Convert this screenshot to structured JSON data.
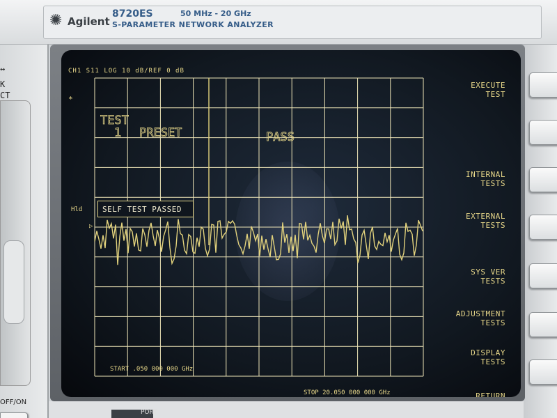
{
  "panel": {
    "brand": "Agilent",
    "model": "8720ES",
    "freq_range": "50 MHz - 20 GHz",
    "description": "S-PARAMETER NETWORK ANALYZER",
    "left_labels": [
      "↔",
      "K",
      "CT"
    ],
    "power_label": "OFF/ON",
    "bottom_label": "PORT"
  },
  "display": {
    "status_line": "CH1  S11  LOG    10 dB/REF 0 dB",
    "star": "*",
    "hold_label": "Hld",
    "marker": "▷",
    "test_label": "TEST",
    "test_number": "1",
    "test_name": "PRESET",
    "result": "PASS",
    "message": "SELF TEST PASSED",
    "start": "START .050 000 000 GHz",
    "stop": "STOP 20.050 000 000 GHz"
  },
  "softkeys": [
    {
      "line1": "EXECUTE",
      "line2": "TEST"
    },
    {
      "line1": "INTERNAL",
      "line2": "TESTS"
    },
    {
      "line1": "EXTERNAL",
      "line2": "TESTS"
    },
    {
      "line1": "SYS VER",
      "line2": "TESTS"
    },
    {
      "line1": "ADJUSTMENT",
      "line2": "TESTS"
    },
    {
      "line1": "DISPLAY",
      "line2": "TESTS"
    },
    {
      "line1": "RETURN",
      "line2": ""
    }
  ],
  "colors": {
    "trace": "#e2d27c",
    "grid": "#efe6b8",
    "text": "#e8d88a",
    "screen": "#111820"
  }
}
